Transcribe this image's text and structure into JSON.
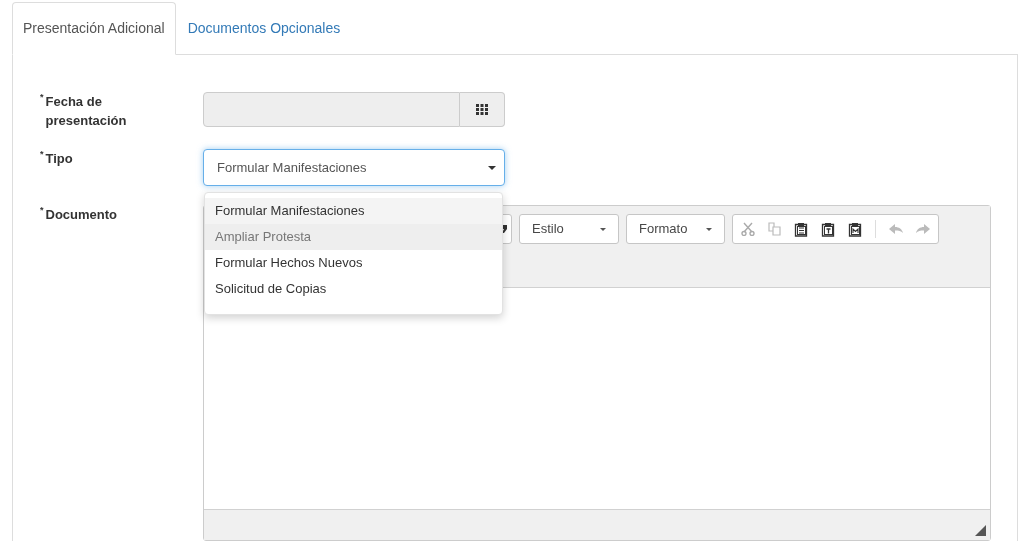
{
  "tabs": [
    {
      "label": "Presentación Adicional",
      "selected": true
    },
    {
      "label": "Documentos Opcionales",
      "selected": false
    }
  ],
  "form": {
    "fields": [
      {
        "kind": "date",
        "required_mark": "*",
        "label": "Fecha de presentación",
        "disabled": true
      },
      {
        "kind": "select",
        "required_mark": "*",
        "label": "Tipo",
        "value": "Formular Manifestaciones",
        "expanded": true,
        "options": [
          {
            "label": "Formular Manifestaciones",
            "selected": true,
            "hovered": false
          },
          {
            "label": "Ampliar Protesta",
            "selected": false,
            "hovered": true
          },
          {
            "label": "Formular Hechos Nuevos",
            "selected": false,
            "hovered": false
          },
          {
            "label": "Solicitud de Copias",
            "selected": false,
            "hovered": false
          }
        ]
      },
      {
        "kind": "editor",
        "required_mark": "*",
        "label": "Documento",
        "toolbar": {
          "dropdowns": [
            "Estilo",
            "Formato"
          ]
        }
      }
    ]
  }
}
